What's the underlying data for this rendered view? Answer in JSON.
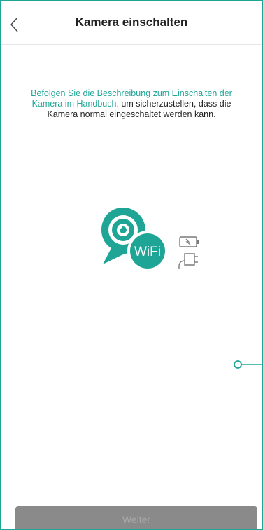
{
  "header": {
    "title": "Kamera einschalten"
  },
  "instruction": {
    "highlight": "Befolgen Sie die Beschreibung zum Einschalten der Kamera im Handbuch,",
    "rest": " um sicherzustellen, dass die Kamera normal eingeschaltet werden kann."
  },
  "illustration": {
    "badge_text": "WiFi",
    "camera_icon": "wifi-camera-icon",
    "power_icons": [
      "battery-icon",
      "power-plug-icon"
    ]
  },
  "footer": {
    "next_label": "Weiter"
  },
  "colors": {
    "accent": "#1fa596",
    "button_disabled": "#8a8a8a",
    "button_text": "#a7a7a7"
  }
}
